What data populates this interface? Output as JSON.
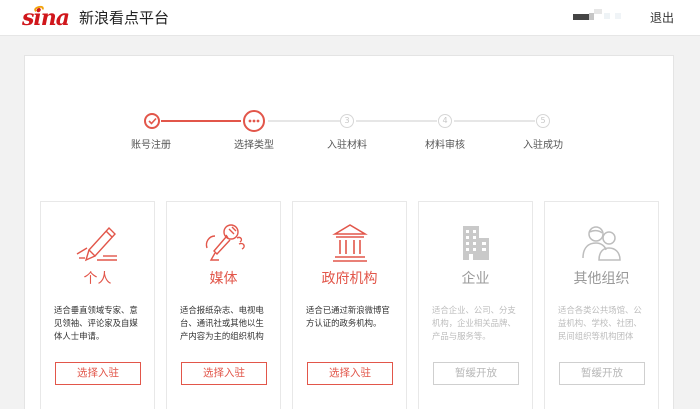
{
  "header": {
    "logo_mark": "sina",
    "logo_text": "新浪看点平台",
    "logout_label": "退出"
  },
  "steps": [
    {
      "index": "✓",
      "label": "账号注册",
      "state": "done"
    },
    {
      "index": "•••",
      "label": "选择类型",
      "state": "current"
    },
    {
      "index": "3",
      "label": "入驻材料",
      "state": "future"
    },
    {
      "index": "4",
      "label": "材料审核",
      "state": "future"
    },
    {
      "index": "5",
      "label": "入驻成功",
      "state": "future"
    }
  ],
  "categories": [
    {
      "title": "个人",
      "icon": "pen-icon",
      "desc": "适合垂直领域专家、意见领袖、评论家及自媒体人士申请。",
      "button": "选择入驻",
      "enabled": true
    },
    {
      "title": "媒体",
      "icon": "microphone-icon",
      "desc": "适合报纸杂志、电视电台、通讯社或其他以生产内容为主的组织机构",
      "button": "选择入驻",
      "enabled": true
    },
    {
      "title": "政府机构",
      "icon": "government-building-icon",
      "desc": "适合已通过新浪微博官方认证的政务机构。",
      "button": "选择入驻",
      "enabled": true
    },
    {
      "title": "企业",
      "icon": "office-building-icon",
      "desc": "适合企业、公司、分支机构，企业相关品牌、产品与服务等。",
      "button": "暂缓开放",
      "enabled": false
    },
    {
      "title": "其他组织",
      "icon": "people-group-icon",
      "desc": "适合各类公共场馆、公益机构、学校、社团、民间组织等机构团体",
      "button": "暂缓开放",
      "enabled": false
    }
  ],
  "colors": {
    "accent": "#e2564a",
    "disabled": "#bdbdbd",
    "background": "#f2f2f2",
    "brand_red": "#d0161b"
  }
}
